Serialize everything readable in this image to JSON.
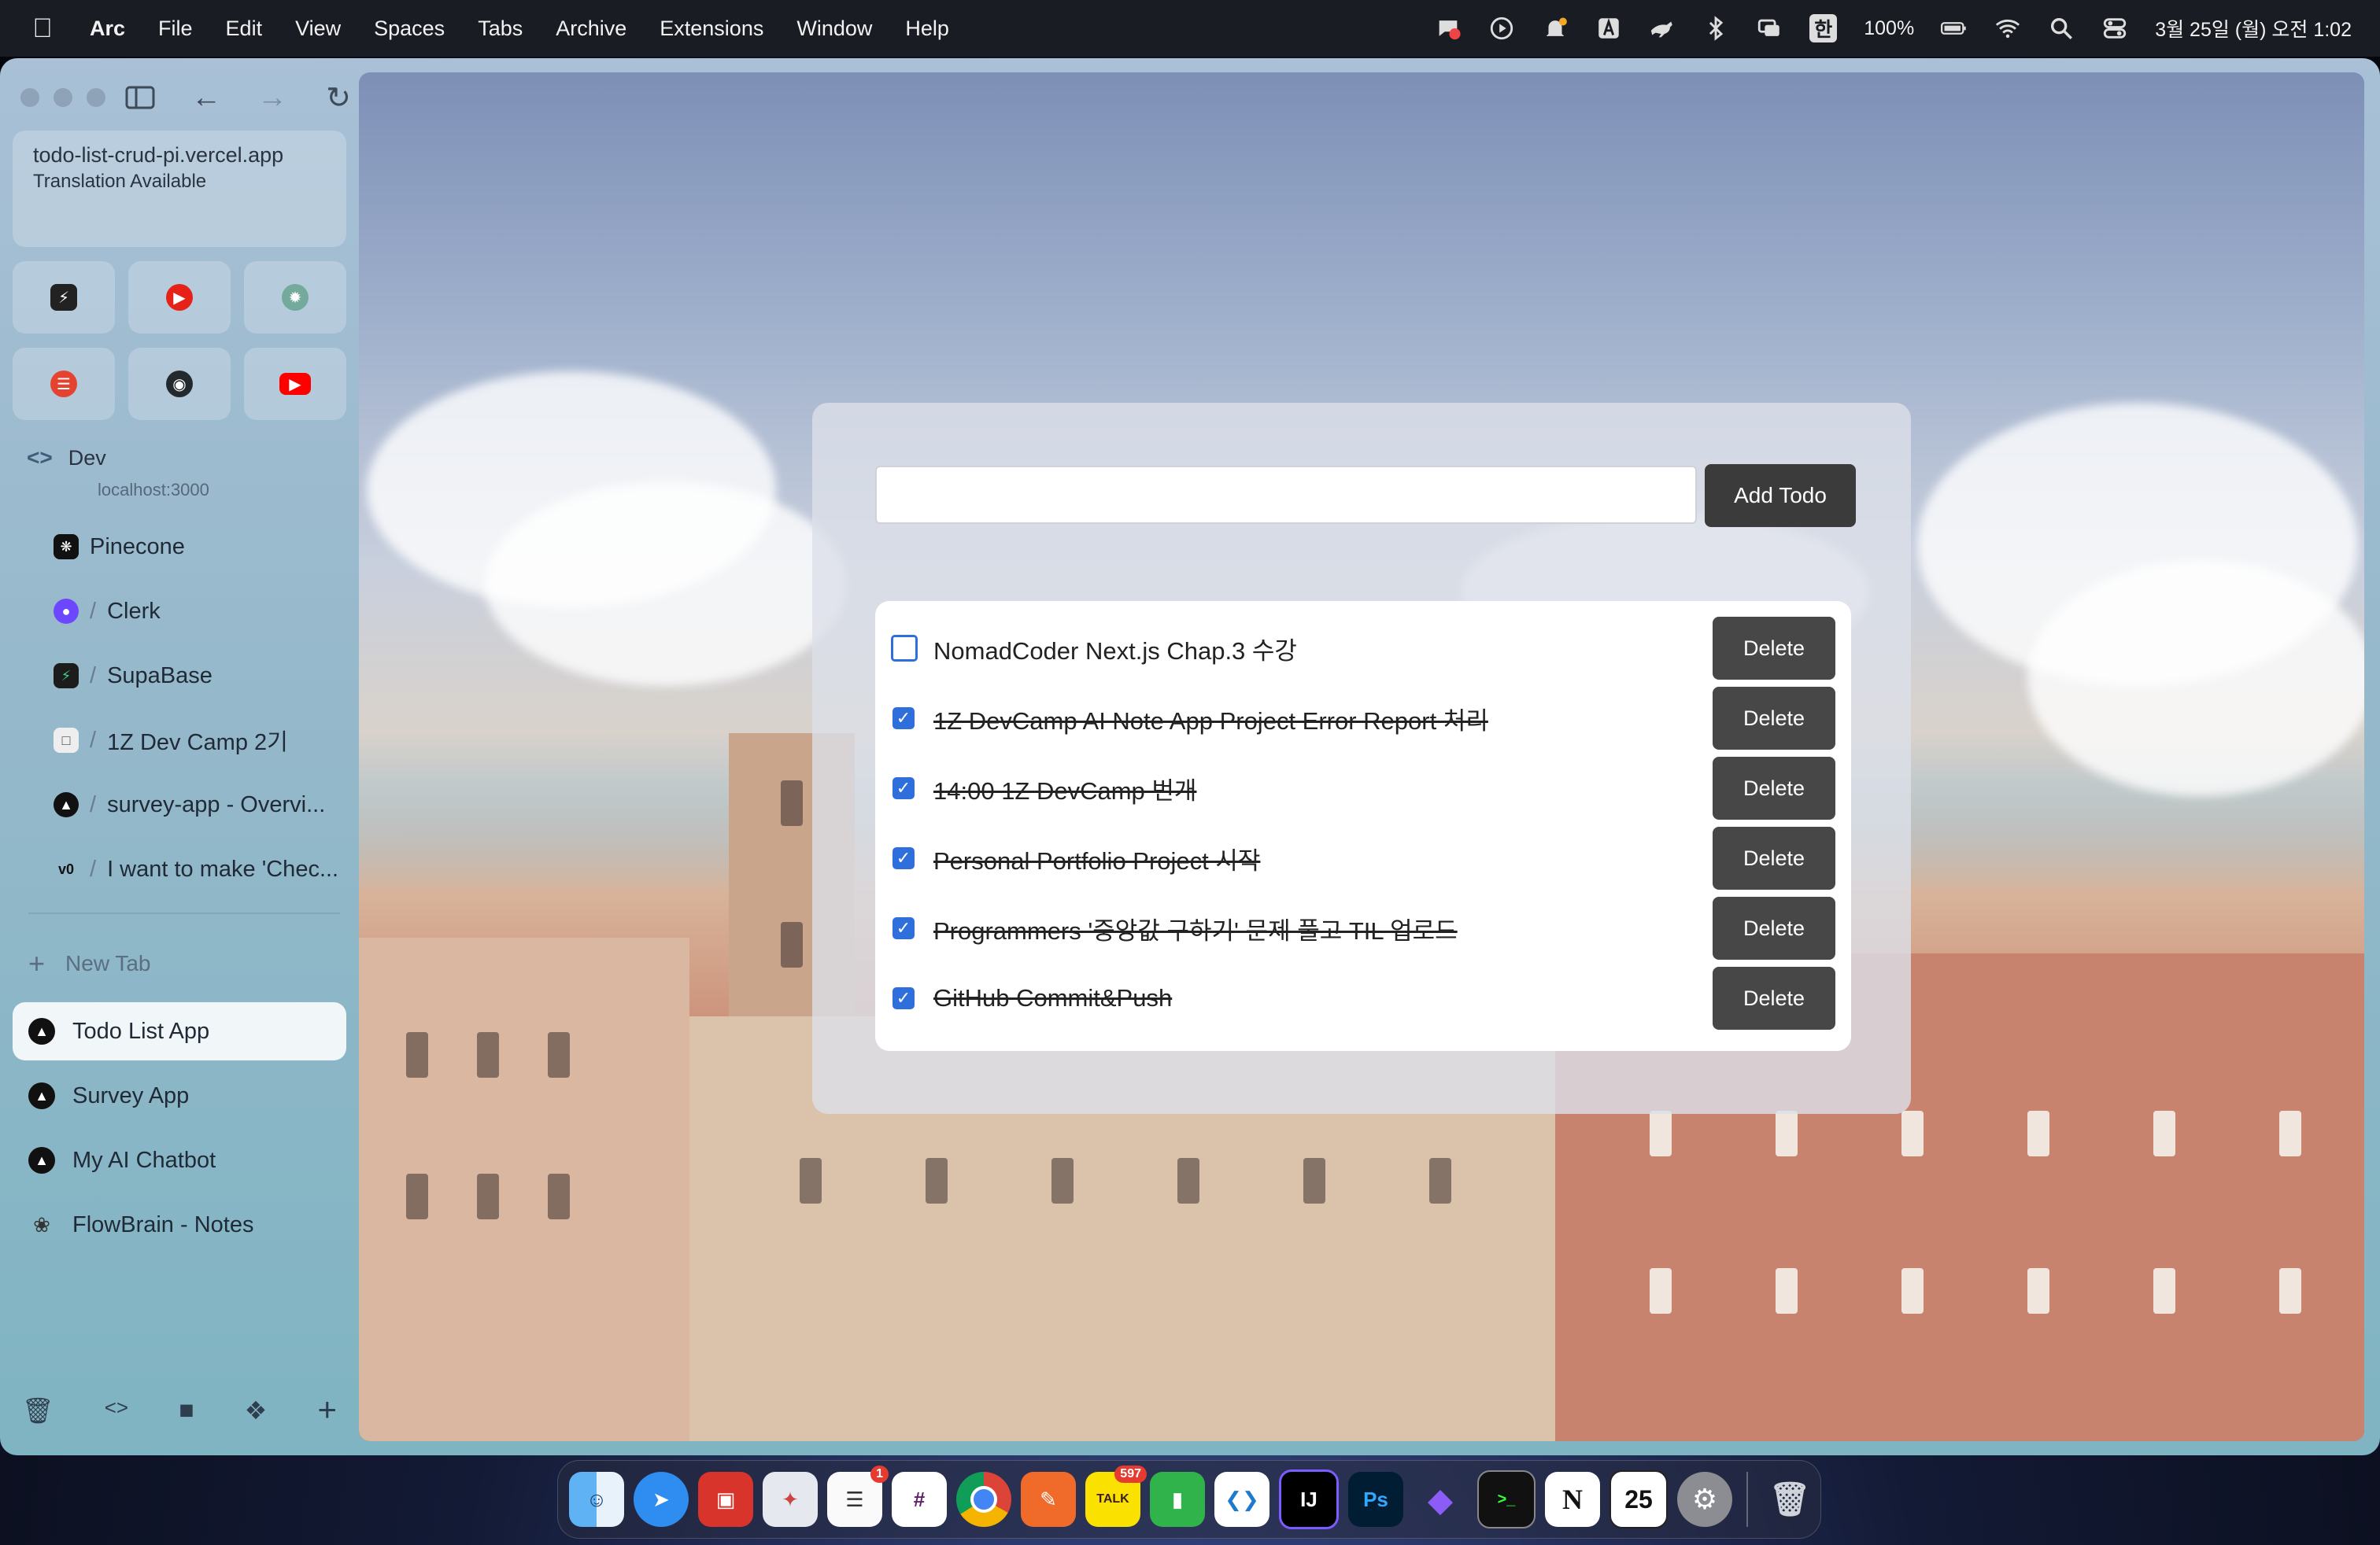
{
  "menubar": {
    "app_name": "Arc",
    "menus": [
      "File",
      "Edit",
      "View",
      "Spaces",
      "Tabs",
      "Archive",
      "Extensions",
      "Window",
      "Help"
    ],
    "battery": "100%",
    "input_lang": "한",
    "datetime": "3월 25일 (월) 오전 1:02"
  },
  "sidebar": {
    "url": "todo-list-crud-pi.vercel.app",
    "translation": "Translation Available",
    "space_name": "Dev",
    "space_hint": "localhost:3000",
    "pinned": [
      {
        "label": "Pinecone"
      },
      {
        "label": "Clerk"
      },
      {
        "label": "SupaBase"
      },
      {
        "label": "1Z Dev Camp 2기"
      },
      {
        "label": "survey-app - Overvi..."
      },
      {
        "label": "I want to make 'Chec..."
      }
    ],
    "new_tab": "New Tab",
    "tabs": [
      {
        "label": "Todo List App"
      },
      {
        "label": "Survey App"
      },
      {
        "label": "My AI Chatbot"
      },
      {
        "label": "FlowBrain - Notes"
      }
    ]
  },
  "todo": {
    "input_value": "",
    "add_label": "Add Todo",
    "delete_label": "Delete",
    "items": [
      {
        "text": "NomadCoder Next.js Chap.3 수강",
        "done": false
      },
      {
        "text": "1Z DevCamp AI Note App Project Error Report 처리",
        "done": true
      },
      {
        "text": "14:00 1Z DevCamp 번개",
        "done": true
      },
      {
        "text": "Personal Portfolio Project 시작",
        "done": true
      },
      {
        "text": "Programmers '중앙값 구하기' 문제 풀고 TIL 업로드",
        "done": true
      },
      {
        "text": "GitHub Commit&Push",
        "done": true
      }
    ]
  },
  "dock": {
    "reminders_badge": "1",
    "kakao_badge": "597",
    "kakao_label": "TALK",
    "calendar_day": "25"
  }
}
